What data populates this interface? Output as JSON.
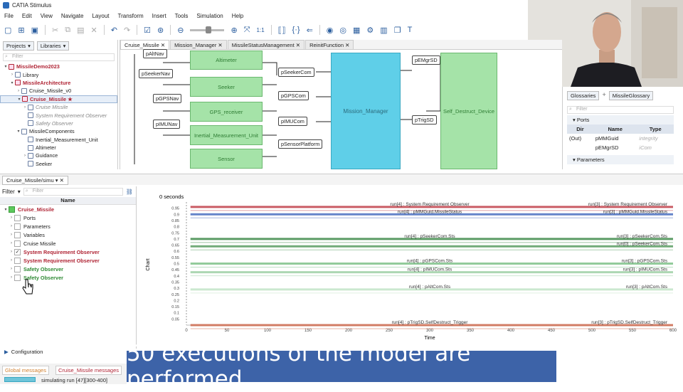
{
  "app": {
    "title": "CATIA Stimulus"
  },
  "menu": [
    "File",
    "Edit",
    "View",
    "Navigate",
    "Layout",
    "Transform",
    "Insert",
    "Tools",
    "Simulation",
    "Help"
  ],
  "left_panel": {
    "tabs": [
      "Projects",
      "Libraries"
    ],
    "filter_placeholder": "Filter",
    "tree": [
      {
        "label": "MissileDemo2023",
        "indent": 0,
        "bold": true,
        "red": true,
        "tw": "▾"
      },
      {
        "label": "Library",
        "indent": 1,
        "tw": "›"
      },
      {
        "label": "MissileArchitecture",
        "indent": 1,
        "bold": true,
        "red": true,
        "tw": "▾"
      },
      {
        "label": "Cruise_Missile_v0",
        "indent": 2,
        "tw": "›"
      },
      {
        "label": "Cruise_Missile ★",
        "indent": 2,
        "bold": true,
        "red": true,
        "tw": "▾"
      },
      {
        "label": "Cruise Missile",
        "indent": 3,
        "gray": true,
        "tw": "›"
      },
      {
        "label": "System Requirement Observer",
        "indent": 3,
        "gray": true,
        "tw": ""
      },
      {
        "label": "Safety Observer",
        "indent": 3,
        "gray": true,
        "tw": ""
      },
      {
        "label": "MissileComponents",
        "indent": 2,
        "tw": "▾"
      },
      {
        "label": "Inertial_Measurement_Unit",
        "indent": 3,
        "tw": ""
      },
      {
        "label": "Altimeter",
        "indent": 3,
        "tw": ""
      },
      {
        "label": "Guidance",
        "indent": 3,
        "tw": "›"
      },
      {
        "label": "Seeker",
        "indent": 3,
        "tw": ""
      }
    ]
  },
  "diagram": {
    "tabs": [
      "Cruise_Missile",
      "Mission_Manager",
      "MissileStatusManagement",
      "ReinitFunction"
    ],
    "blocks": [
      "Altimeter",
      "Seeker",
      "GPS_receiver",
      "Inertial_Measurement_Unit",
      "Sensor"
    ],
    "ports_left": [
      "pAltNav",
      "pSeekerNav",
      "pGPSNav",
      "pIMUNav"
    ],
    "ports_mid": [
      "pSeekerCom",
      "pGPSCom",
      "pIMUCom",
      "pSensorPlatform"
    ],
    "main_block": "Mission_Manager",
    "ports_right": [
      "pEMgrSD",
      "pTrigSD"
    ],
    "right_block": "Self_Destruct_Device"
  },
  "glossary": {
    "tabs": [
      "Glossaries",
      "MissileGlossary"
    ],
    "filter_placeholder": "Filter",
    "ports_header": "Ports",
    "columns": [
      "Dir",
      "Name",
      "Type"
    ],
    "rows": [
      {
        "dir": "(Out)",
        "name": "pMMGuid",
        "type": "integrity"
      },
      {
        "dir": "",
        "name": "pEMgrSD",
        "type": "iCom"
      }
    ],
    "parameters_header": "Parameters"
  },
  "sim_panel": {
    "tab": "Cruise_Missile/simu",
    "filter_label": "Filter",
    "filter_placeholder": "Filter",
    "column_name": "Name",
    "rows": [
      {
        "label": "Cruise_Missile",
        "indent": 0,
        "bold": true,
        "red": true
      },
      {
        "label": "Ports",
        "indent": 1
      },
      {
        "label": "Parameters",
        "indent": 1
      },
      {
        "label": "Variables",
        "indent": 1
      },
      {
        "label": "Cruise Missile",
        "indent": 1
      },
      {
        "label": "System Requirement Observer",
        "indent": 1,
        "bold": true,
        "red": true,
        "checked": true
      },
      {
        "label": "System Requirement Observer",
        "indent": 1,
        "bold": true,
        "red": true
      },
      {
        "label": "Safety Observer",
        "indent": 1,
        "bold": true,
        "green": true
      },
      {
        "label": "Safety Observer",
        "indent": 1,
        "bold": true,
        "green": true
      }
    ],
    "configuration": "Configuration"
  },
  "chart_data": {
    "type": "line",
    "time_label": "0 seconds",
    "xlabel": "Time",
    "ylabel": "Chart",
    "xlim": [
      0,
      600
    ],
    "x_ticks": [
      0,
      50,
      100,
      150,
      200,
      250,
      300,
      350,
      400,
      450,
      500,
      550,
      600
    ],
    "ylim": [
      0,
      1
    ],
    "y_ticks": [
      0.05,
      0.1,
      0.15,
      0.2,
      0.25,
      0.3,
      0.35,
      0.4,
      0.45,
      0.5,
      0.55,
      0.6,
      0.65,
      0.7,
      0.75,
      0.8,
      0.85,
      0.9,
      0.95
    ],
    "series": [
      {
        "left": "run[4] : System Requirement Observer",
        "right": "run[3] : System Requirement Observer",
        "y": 0.96,
        "color": "#c0404a"
      },
      {
        "left": "run[4] : pMMGuid.MissileStatus",
        "right": "run[3] : pMMGuid.MissileStatus",
        "y": 0.9,
        "color": "#4a6fc0"
      },
      {
        "left": "run[4] : pSeekerCom.Sts",
        "right": "run[3] : pSeekerCom.Sts",
        "y": 0.7,
        "color": "#3f8a4a"
      },
      {
        "left": "",
        "right": "run[0] : pSeekerCom.Sts",
        "y": 0.64,
        "color": "#5a9e62"
      },
      {
        "left": "run[4] : pGPSCom.Sts",
        "right": "run[3] : pGPSCom.Sts",
        "y": 0.5,
        "color": "#7fc28a"
      },
      {
        "left": "run[4] : pIMUCom.Sts",
        "right": "run[3] : pIMUCom.Sts",
        "y": 0.43,
        "color": "#9fd1a6"
      },
      {
        "left": "run[4] : pAltCom.Sts",
        "right": "run[3] : pAltCom.Sts",
        "y": 0.29,
        "color": "#c3e4c7"
      },
      {
        "left": "run[4] : pTrigSD.SelfDestruct_Trigger",
        "right": "run[3] : pTrigSD.SelfDestruct_Trigger",
        "y": 0.0,
        "color": "#d06a50"
      }
    ]
  },
  "caption": "50 executions of the model are performed",
  "status": {
    "tab1": "Global messages",
    "tab2": "Cruise_Missile messages",
    "text": "simulating run [47][300-400]"
  }
}
